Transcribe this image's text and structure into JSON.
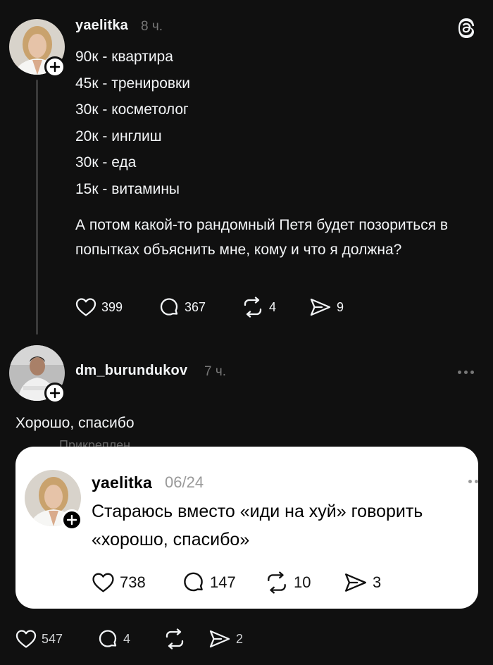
{
  "post": {
    "username": "yaelitka",
    "time": "8 ч.",
    "lines": [
      "90к - квартира",
      "45к - тренировки",
      "30к - косметолог",
      "20к - инглиш",
      "30к - еда",
      "15к - витамины"
    ],
    "paragraph": "А потом какой-то рандомный Петя будет позориться в попытках объяснить мне, кому и что я должна?",
    "likes": "399",
    "comments": "367",
    "reposts": "4",
    "shares": "9"
  },
  "reply": {
    "username": "dm_burundukov",
    "time": "7 ч.",
    "text": "Хорошо, спасибо",
    "likes": "547",
    "comments": "4",
    "reposts": "",
    "shares": "2"
  },
  "pinned_peek": "Прикреплен",
  "quote": {
    "username": "yaelitka",
    "time": "06/24",
    "text": "Стараюсь вместо «иди на хуй» говорить «хорошо, спасибо»",
    "likes": "738",
    "comments": "147",
    "reposts": "10",
    "shares": "3"
  },
  "icons": {
    "app": "threads-logo-icon",
    "like": "heart-icon",
    "comment": "comment-bubble-icon",
    "repost": "repost-icon",
    "share": "send-icon",
    "follow": "plus-icon",
    "more": "more-dots-icon"
  },
  "colors": {
    "background": "#101010",
    "text": "#f3f5f7",
    "muted": "#777777",
    "card": "#ffffff"
  }
}
